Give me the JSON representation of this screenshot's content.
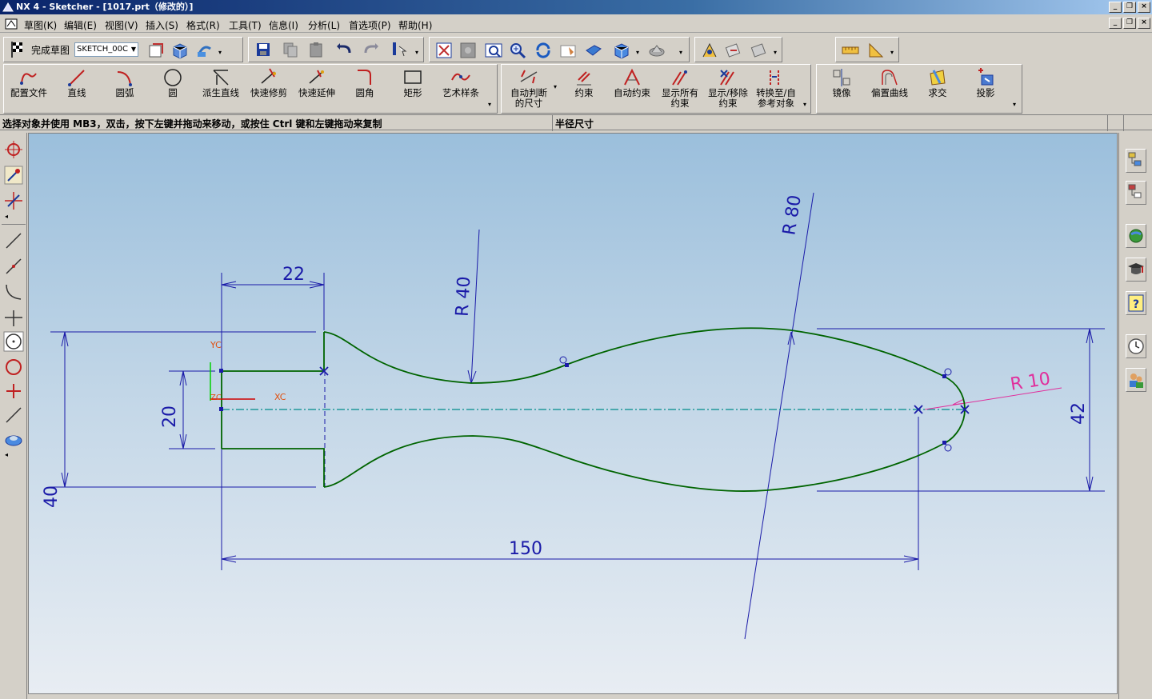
{
  "window": {
    "title": "NX 4 - Sketcher - [1017.prt（修改的）]"
  },
  "menu": {
    "items": [
      "草图(K)",
      "编辑(E)",
      "视图(V)",
      "插入(S)",
      "格式(R)",
      "工具(T)",
      "信息(I)",
      "分析(L)",
      "首选项(P)",
      "帮助(H)"
    ]
  },
  "toolbar": {
    "finish_sketch": "完成草图",
    "sketch_name": "SKETCH_00C"
  },
  "sketch_tools": {
    "profile": "配置文件",
    "line": "直线",
    "arc": "圆弧",
    "circle": "圆",
    "derived_line": "派生直线",
    "quick_trim": "快速修剪",
    "quick_extend": "快速延伸",
    "fillet": "圆角",
    "rectangle": "矩形",
    "studio_spline": "艺术样条"
  },
  "constraint_tools": {
    "inferred_dim_1": "自动判断",
    "inferred_dim_2": "的尺寸",
    "constraints": "约束",
    "auto_constrain": "自动约束",
    "show_all_1": "显示所有",
    "show_all_2": "约束",
    "show_remove_1": "显示/移除",
    "show_remove_2": "约束",
    "convert_1": "转换至/自",
    "convert_2": "参考对象"
  },
  "op_tools": {
    "mirror": "镜像",
    "offset": "偏置曲线",
    "intersect": "求交",
    "project": "投影"
  },
  "status": {
    "prompt": "选择对象并使用 MB3，双击，按下左键并拖动来移动，或按住 Ctrl 键和左键拖动来复制",
    "info": "半径尺寸"
  },
  "drawing": {
    "dims": {
      "d22": "22",
      "r40": "R 40",
      "r80": "R 80",
      "r10": "R 10",
      "d42": "42",
      "d20": "20",
      "d40": "40",
      "d150": "150"
    },
    "axes": {
      "yc": "YC",
      "xc": "XC",
      "zc": "ZC"
    },
    "colors": {
      "geometry": "#006400",
      "dimension": "#1a1aa8",
      "centerline": "#008b8b",
      "radius_active": "#e0309c",
      "axis": "#e05010"
    }
  }
}
